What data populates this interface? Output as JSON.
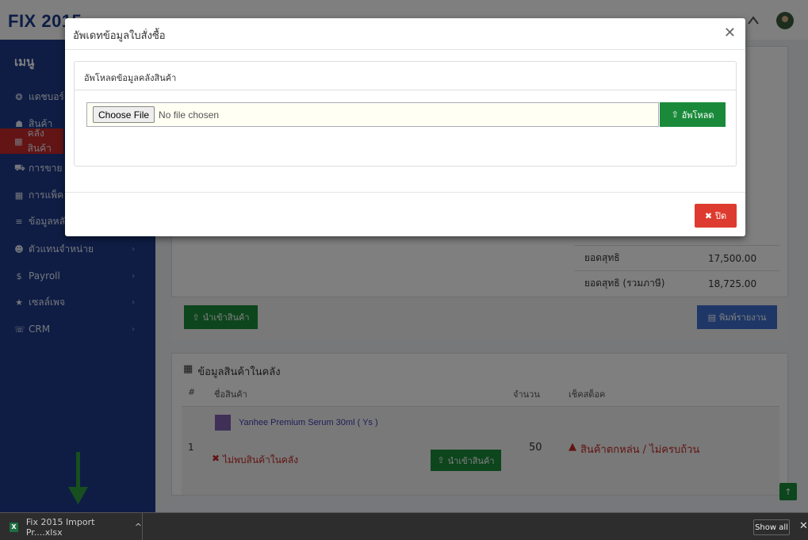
{
  "app": {
    "logo": "FIX 2015"
  },
  "sidebar": {
    "title": "เมนู",
    "items": [
      {
        "label": "แดชบอร์ด",
        "icon": "dashboard-icon",
        "glyph": "❂"
      },
      {
        "label": "สินค้า",
        "icon": "products-icon",
        "glyph": "☗"
      },
      {
        "label": "คลังสินค้า",
        "icon": "warehouse-icon",
        "glyph": "▦",
        "active": true
      },
      {
        "label": "การขาย",
        "icon": "cart-icon",
        "glyph": "⛟"
      },
      {
        "label": "การแพ็ค",
        "icon": "pack-icon",
        "glyph": "▦"
      },
      {
        "label": "ข้อมูลหลัก",
        "icon": "database-icon",
        "glyph": "≡"
      },
      {
        "label": "ตัวแทนจำหน่าย",
        "icon": "dealers-icon",
        "glyph": "☻"
      },
      {
        "label": "Payroll",
        "icon": "payroll-icon",
        "glyph": "$"
      },
      {
        "label": "เซลล์เพจ",
        "icon": "star-icon",
        "glyph": "★"
      },
      {
        "label": "CRM",
        "icon": "crm-icon",
        "glyph": "☏"
      }
    ]
  },
  "summary": {
    "rows": [
      {
        "label": "ยอดสุทธิ",
        "value": "17,500.00"
      },
      {
        "label": "ยอดสุทธิ (รวมภาษี)",
        "value": "18,725.00"
      }
    ],
    "import_button": "นำเข้าสินค้า",
    "print_button": "พิมพ์รายงาน"
  },
  "stock_panel": {
    "title": "ข้อมูลสินค้าในคลัง",
    "headers": [
      "#",
      "ชื่อสินค้า",
      "จำนวน",
      "เช็คสต็อค"
    ],
    "row": {
      "index": "1",
      "product": "Yanhee Premium Serum 30ml ( Ys )",
      "not_found": "ไม่พบสินค้าในคลัง",
      "import_button": "นำเข้าสินค้า",
      "qty": "50",
      "status": "สินค้าตกหล่น / ไม่ครบถ้วน"
    }
  },
  "modal": {
    "title": "อัพเดทข้อมูลใบสั่งซื้อ",
    "panel_title": "อัพโหลดข้อมูลคลังสินค้า",
    "choose_file": "Choose File",
    "no_file": "No file chosen",
    "upload_button": "อัพโหลด",
    "close_button": "ปิด"
  },
  "downloads": {
    "file": "Fix 2015 Import Pr....xlsx",
    "show_all": "Show all"
  },
  "colors": {
    "sidebar": "#1e3a8a",
    "green": "#1a8a3a",
    "red": "#dd3b2f",
    "blue": "#3c6ecf"
  }
}
